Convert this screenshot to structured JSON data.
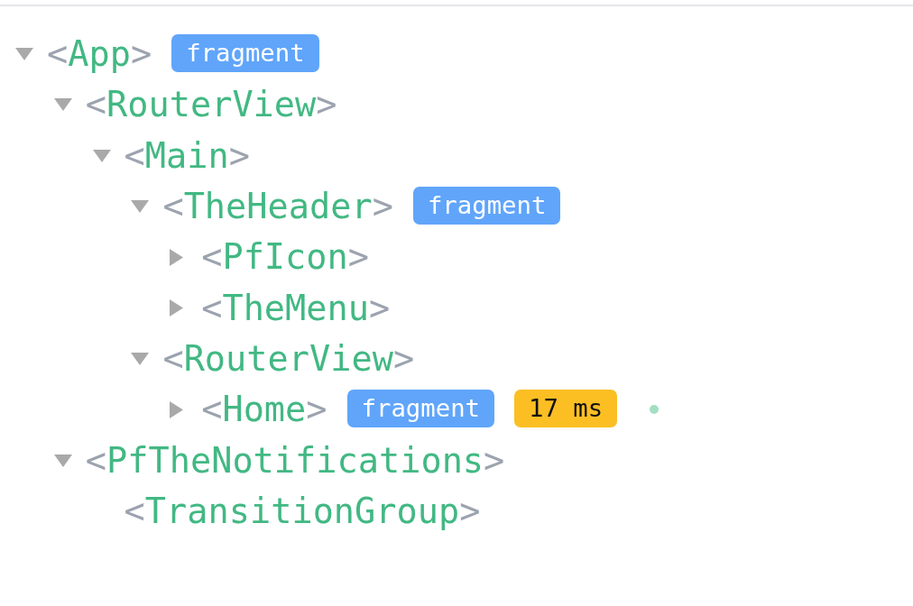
{
  "tree": [
    {
      "open": "<",
      "name": "App",
      "close": ">",
      "expanded": true,
      "badges": [
        {
          "kind": "fragment",
          "label": "fragment"
        }
      ],
      "children": [
        {
          "open": "<",
          "name": "RouterView",
          "close": ">",
          "expanded": true,
          "children": [
            {
              "open": "<",
              "name": "Main",
              "close": ">",
              "expanded": true,
              "children": [
                {
                  "open": "<",
                  "name": "TheHeader",
                  "close": ">",
                  "expanded": true,
                  "badges": [
                    {
                      "kind": "fragment",
                      "label": "fragment"
                    }
                  ],
                  "children": [
                    {
                      "open": "<",
                      "name": "PfIcon",
                      "close": ">",
                      "expanded": false
                    },
                    {
                      "open": "<",
                      "name": "TheMenu",
                      "close": ">",
                      "expanded": false
                    }
                  ]
                },
                {
                  "open": "<",
                  "name": "RouterView",
                  "close": ">",
                  "expanded": true,
                  "children": [
                    {
                      "open": "<",
                      "name": "Home",
                      "close": ">",
                      "expanded": false,
                      "badges": [
                        {
                          "kind": "fragment",
                          "label": "fragment"
                        },
                        {
                          "kind": "timing",
                          "label": "17 ms"
                        }
                      ],
                      "indicator": true
                    }
                  ]
                }
              ]
            }
          ]
        },
        {
          "open": "<",
          "name": "PfTheNotifications",
          "close": ">",
          "expanded": true,
          "children": [
            {
              "open": "<",
              "name": "TransitionGroup",
              "close": ">"
            }
          ]
        }
      ]
    }
  ]
}
